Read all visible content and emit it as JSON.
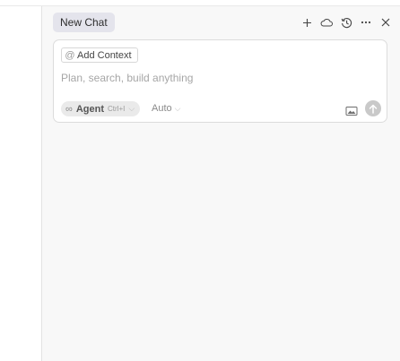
{
  "tab": {
    "title": "New Chat"
  },
  "toolbar": {
    "icons": [
      "plus-icon",
      "cloud-icon",
      "history-icon",
      "more-icon",
      "close-icon"
    ]
  },
  "composer": {
    "add_context_symbol": "@",
    "add_context_label": "Add Context",
    "placeholder": "Plan, search, build anything",
    "mode_symbol": "∞",
    "mode_label": "Agent",
    "mode_shortcut": "Ctrl+I",
    "model_label": "Auto"
  },
  "colors": {
    "panel_bg": "#f8f8f8",
    "tab_bg": "#e4e4ec",
    "send_button": "#c9c9c9"
  }
}
